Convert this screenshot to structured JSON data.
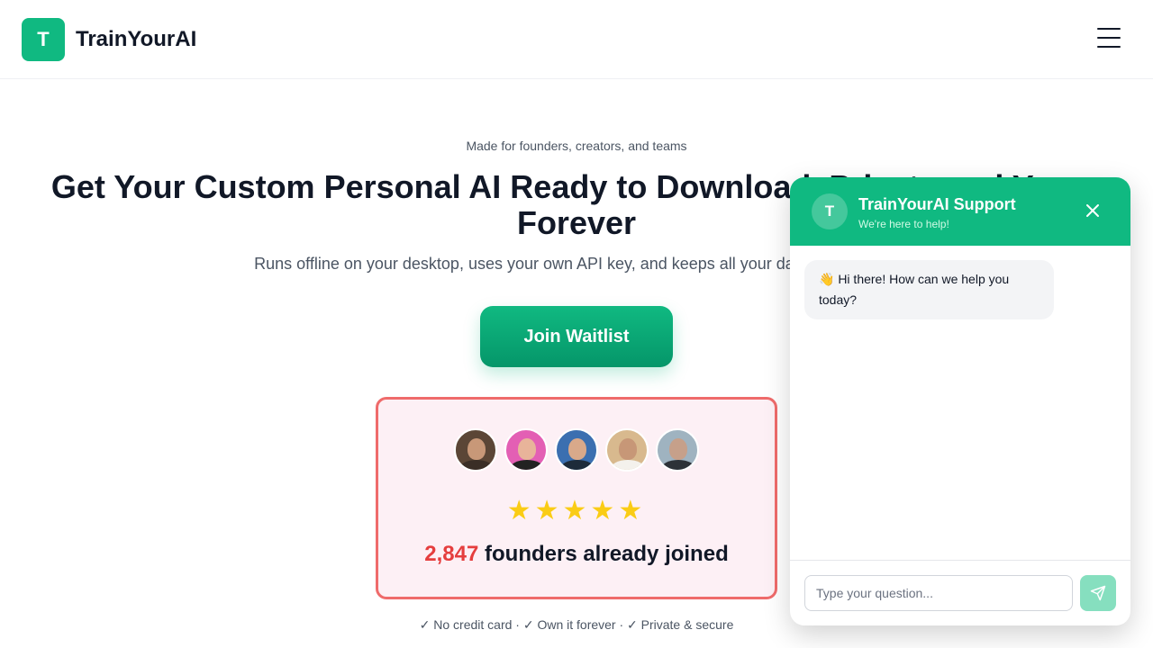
{
  "header": {
    "logo_letter": "T",
    "brand": "TrainYourAI",
    "menu_icon": "hamburger-icon"
  },
  "hero": {
    "tagline": "Made for founders, creators, and teams",
    "headline": "Get Your Custom Personal AI Ready to Download. Private and Yours Forever",
    "subheadline": "Runs offline on your desktop, uses your own API key, and keeps all your data fully private.",
    "cta_label": "Join Waitlist"
  },
  "social_proof": {
    "rating_stars": 5,
    "stars": "★★★★★",
    "count": "2,847",
    "label": "founders already joined",
    "avatars": [
      {
        "bg": "#5b4636",
        "skin": "#c89878",
        "shirt": "#3a2e26"
      },
      {
        "bg": "#e35fb4",
        "skin": "#e8b49a",
        "shirt": "#222222"
      },
      {
        "bg": "#3b6fb0",
        "skin": "#d9a98a",
        "shirt": "#1d2b3a"
      },
      {
        "bg": "#d8b98e",
        "skin": "#c79777",
        "shirt": "#f4f1ec"
      },
      {
        "bg": "#9fb3c0",
        "skin": "#c6a08a",
        "shirt": "#2d3238"
      }
    ]
  },
  "guarantees": "✓ No credit card · ✓ Own it forever · ✓ Private & secure",
  "chat": {
    "avatar_letter": "T",
    "title": "TrainYourAI Support",
    "subtitle": "We're here to help!",
    "close_icon": "close-icon",
    "greeting": "👋 Hi there! How can we help you today?",
    "input_placeholder": "Type your question...",
    "send_icon": "send-icon"
  },
  "colors": {
    "brand": "#10b981",
    "card_border": "#ef6b6b",
    "count": "#e53e3e",
    "stars": "#facc15"
  }
}
